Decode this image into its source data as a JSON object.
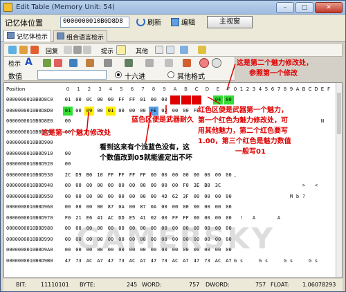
{
  "window": {
    "title": "Edit Table (Memory Unit: 54)",
    "buttons": {
      "minimize": "–",
      "maximize": "□",
      "close": "✕"
    }
  },
  "address_bar": {
    "label": "记忆体位置",
    "address": "0000000010B0D8D8",
    "refresh_label": "刷新",
    "edit_label": "编辑",
    "main_window_label": "主视窗"
  },
  "tabs": [
    {
      "label": "记忆体检示"
    },
    {
      "label": "组合语言检示"
    }
  ],
  "toolbar": {
    "restore_label": "回复",
    "hint_label": "提示",
    "other_label": "其他",
    "search_label": "检示",
    "value_label": "数值",
    "hex_label": "十六进",
    "other_format_label": "其他格式"
  },
  "grid": {
    "position_header": "Position",
    "hex_headers": [
      "0",
      "1",
      "2",
      "3",
      "4",
      "5",
      "6",
      "7",
      "8",
      "9",
      "A",
      "B",
      "C",
      "D",
      "E",
      "F"
    ],
    "ascii_headers": [
      "0",
      "1",
      "2",
      "3",
      "4",
      "5",
      "6",
      "7",
      "8",
      "9",
      "A",
      "B",
      "C",
      "D",
      "E",
      "F"
    ],
    "rows": [
      {
        "addr": "0000000010B0D8C0",
        "cells": [
          "01",
          "00",
          "0C",
          "00",
          "00",
          "FF",
          "FF",
          "01",
          "00",
          "00",
          "",
          "",
          "",
          "",
          "04",
          "00"
        ],
        "ascii": [
          "",
          "",
          "",
          "",
          "",
          "",
          "",
          "",
          "",
          "",
          "",
          "",
          "",
          "",
          "",
          ""
        ]
      },
      {
        "addr": "0000000010B0D8D0",
        "cells": [
          "01",
          "00",
          "09",
          "00",
          "01",
          "00",
          "00",
          "00",
          "FE",
          "02",
          "00",
          "00",
          "FE",
          "",
          "",
          ""
        ],
        "ascii": [
          "",
          "",
          "",
          "",
          "",
          "",
          "",
          "",
          "",
          "",
          "",
          "",
          "",
          "",
          "",
          ""
        ]
      },
      {
        "addr": "0000000010B0D8E0",
        "cells": [
          "00",
          "",
          "",
          "",
          "",
          "",
          "",
          "",
          "",
          "",
          "",
          "",
          "",
          "",
          "",
          ""
        ],
        "ascii": [
          "",
          "",
          "",
          "",
          "",
          "",
          "",
          "",
          "",
          "",
          "",
          "",
          "",
          "",
          "N",
          ""
        ]
      },
      {
        "addr": "0000000010B0D8F0",
        "cells": [
          "00",
          "",
          "",
          "",
          "",
          "",
          "",
          "",
          "",
          "",
          "",
          "",
          "",
          "",
          "",
          ""
        ],
        "ascii": [
          "",
          "",
          "",
          "",
          "",
          "",
          "",
          "",
          "",
          "",
          "",
          "",
          "",
          "",
          "",
          ""
        ]
      },
      {
        "addr": "0000000010B0D900",
        "cells": [
          "",
          "",
          "",
          "",
          "",
          "",
          "",
          "",
          "",
          "",
          "",
          "",
          "",
          "",
          "",
          ""
        ],
        "ascii": [
          "",
          "",
          "",
          "",
          "",
          "",
          "",
          "",
          "",
          "",
          "",
          "",
          "",
          "",
          "",
          ""
        ]
      },
      {
        "addr": "0000000010B0D910",
        "cells": [
          "00",
          "",
          "",
          "",
          "",
          "",
          "",
          "",
          "",
          "",
          "",
          "",
          "",
          "",
          "",
          ""
        ],
        "ascii": [
          "",
          "",
          "",
          "",
          "",
          "",
          "",
          "",
          "",
          "",
          "",
          "",
          "",
          "",
          "",
          ""
        ]
      },
      {
        "addr": "0000000010B0D920",
        "cells": [
          "00",
          "",
          "",
          "",
          "",
          "",
          "",
          "",
          "",
          "",
          "",
          "",
          "",
          "",
          "",
          ""
        ],
        "ascii": [
          "",
          "",
          "",
          "",
          "",
          "",
          "",
          "",
          "",
          "",
          "",
          "",
          "",
          "",
          "",
          ""
        ]
      },
      {
        "addr": "0000000010B0D930",
        "cells": [
          "2C",
          "D9",
          "B0",
          "10",
          "FF",
          "FF",
          "FF",
          "FF",
          "00",
          "00",
          "00",
          "00",
          "00",
          "00",
          "00",
          "00"
        ],
        "ascii": [
          ",",
          "",
          "",
          "",
          "",
          "",
          "",
          "",
          "",
          "",
          "",
          "",
          "",
          "",
          "",
          ""
        ]
      },
      {
        "addr": "0000000010B0D940",
        "cells": [
          "00",
          "00",
          "00",
          "00",
          "00",
          "00",
          "00",
          "00",
          "00",
          "00",
          "00",
          "F0",
          "3E",
          "B8",
          "3C",
          ""
        ],
        "ascii": [
          "",
          "",
          "",
          "",
          "",
          "",
          "",
          "",
          "",
          "",
          "",
          ">",
          "",
          "<",
          "",
          ""
        ]
      },
      {
        "addr": "0000000010B0D950",
        "cells": [
          "00",
          "00",
          "00",
          "00",
          "00",
          "00",
          "00",
          "00",
          "00",
          "4D",
          "62",
          "3F",
          "00",
          "00",
          "00",
          "00"
        ],
        "ascii": [
          "",
          "",
          "",
          "",
          "",
          "",
          "",
          "",
          "",
          "M",
          "b",
          "?",
          "",
          "",
          "",
          ""
        ]
      },
      {
        "addr": "0000000010B0D960",
        "cells": [
          "00",
          "00",
          "00",
          "00",
          "87",
          "0A",
          "00",
          "87",
          "0A",
          "00",
          "00",
          "00",
          "00",
          "00",
          "00",
          "00"
        ],
        "ascii": [
          "",
          "",
          "",
          "",
          "",
          "",
          "",
          "",
          "",
          "",
          "",
          "",
          "",
          "",
          "",
          ""
        ]
      },
      {
        "addr": "0000000010B0D970",
        "cells": [
          "F0",
          "21",
          "E6",
          "41",
          "AC",
          "DD",
          "E5",
          "41",
          "02",
          "00",
          "FF",
          "FF",
          "00",
          "00",
          "00",
          "00"
        ],
        "ascii": [
          "",
          "!",
          "",
          "A",
          "",
          "",
          "",
          "A",
          "",
          "",
          "",
          "",
          "",
          "",
          "",
          ""
        ]
      },
      {
        "addr": "0000000010B0D980",
        "cells": [
          "00",
          "00",
          "00",
          "00",
          "00",
          "00",
          "00",
          "00",
          "00",
          "00",
          "00",
          "00",
          "00",
          "00",
          "00",
          "00"
        ],
        "ascii": [
          "",
          "",
          "",
          "",
          "",
          "",
          "",
          "",
          "",
          "",
          "",
          "",
          "",
          "",
          "",
          ""
        ]
      },
      {
        "addr": "0000000010B0D990",
        "cells": [
          "00",
          "00",
          "00",
          "00",
          "00",
          "00",
          "00",
          "00",
          "00",
          "00",
          "00",
          "00",
          "00",
          "00",
          "00",
          "00"
        ],
        "ascii": [
          "",
          "",
          "",
          "",
          "",
          "",
          "",
          "",
          "",
          "",
          "",
          "",
          "",
          "",
          "",
          ""
        ]
      },
      {
        "addr": "0000000010B0D9A0",
        "cells": [
          "00",
          "00",
          "00",
          "00",
          "00",
          "00",
          "00",
          "00",
          "00",
          "00",
          "00",
          "00",
          "00",
          "00",
          "00",
          "00"
        ],
        "ascii": [
          "",
          "",
          "",
          "",
          "",
          "",
          "",
          "",
          "",
          "",
          "",
          "",
          "",
          "",
          "",
          ""
        ]
      },
      {
        "addr": "0000000010B0D9B0",
        "cells": [
          "47",
          "73",
          "AC",
          "A7",
          "47",
          "73",
          "AC",
          "A7",
          "47",
          "73",
          "AC",
          "A7",
          "47",
          "73",
          "AC",
          "A7"
        ],
        "ascii": [
          "G",
          "s",
          "",
          "",
          "G",
          "s",
          "",
          "",
          "G",
          "s",
          "",
          "",
          "G",
          "s",
          "",
          ""
        ]
      }
    ]
  },
  "status": {
    "bit_label": "BIT:",
    "bit_value": "11110101",
    "byte_label": "BYTE:",
    "byte_value": "245",
    "word_label": "WORD:",
    "word_value": "757",
    "dword_label": "DWORD:",
    "dword_value": "757",
    "float_label": "FLOAT:",
    "float_value": "1.06078293"
  },
  "annotations": {
    "top_right_line1": "这是第二个魅力修改处，",
    "top_right_line2": "参照第一个修改",
    "red_area_line1": "红色区便是武器第一个魅力，",
    "red_area_line2": "第一个红色为魅力修改处，可",
    "red_area_line3": "用其他魅力，第二个红色要写",
    "red_area_line4": "1.00，第三个红色是魅力数值",
    "red_area_line5": "一般写01",
    "blue_area": "蓝色区便是武器耐久",
    "first_charm": "这是第一个魅力修改处",
    "light_blue_line1": "看到这来有个浅蓝色没有，这",
    "light_blue_line2": "个数值改到05就能鉴定出不坏"
  },
  "watermark": "GAMERSKY",
  "colors": {
    "red_highlight": "#e00000",
    "green_highlight": "#33dd33",
    "yellow_highlight": "#ffee00",
    "blue_highlight": "#5aa0e8",
    "annotation_text": "#e00000"
  }
}
